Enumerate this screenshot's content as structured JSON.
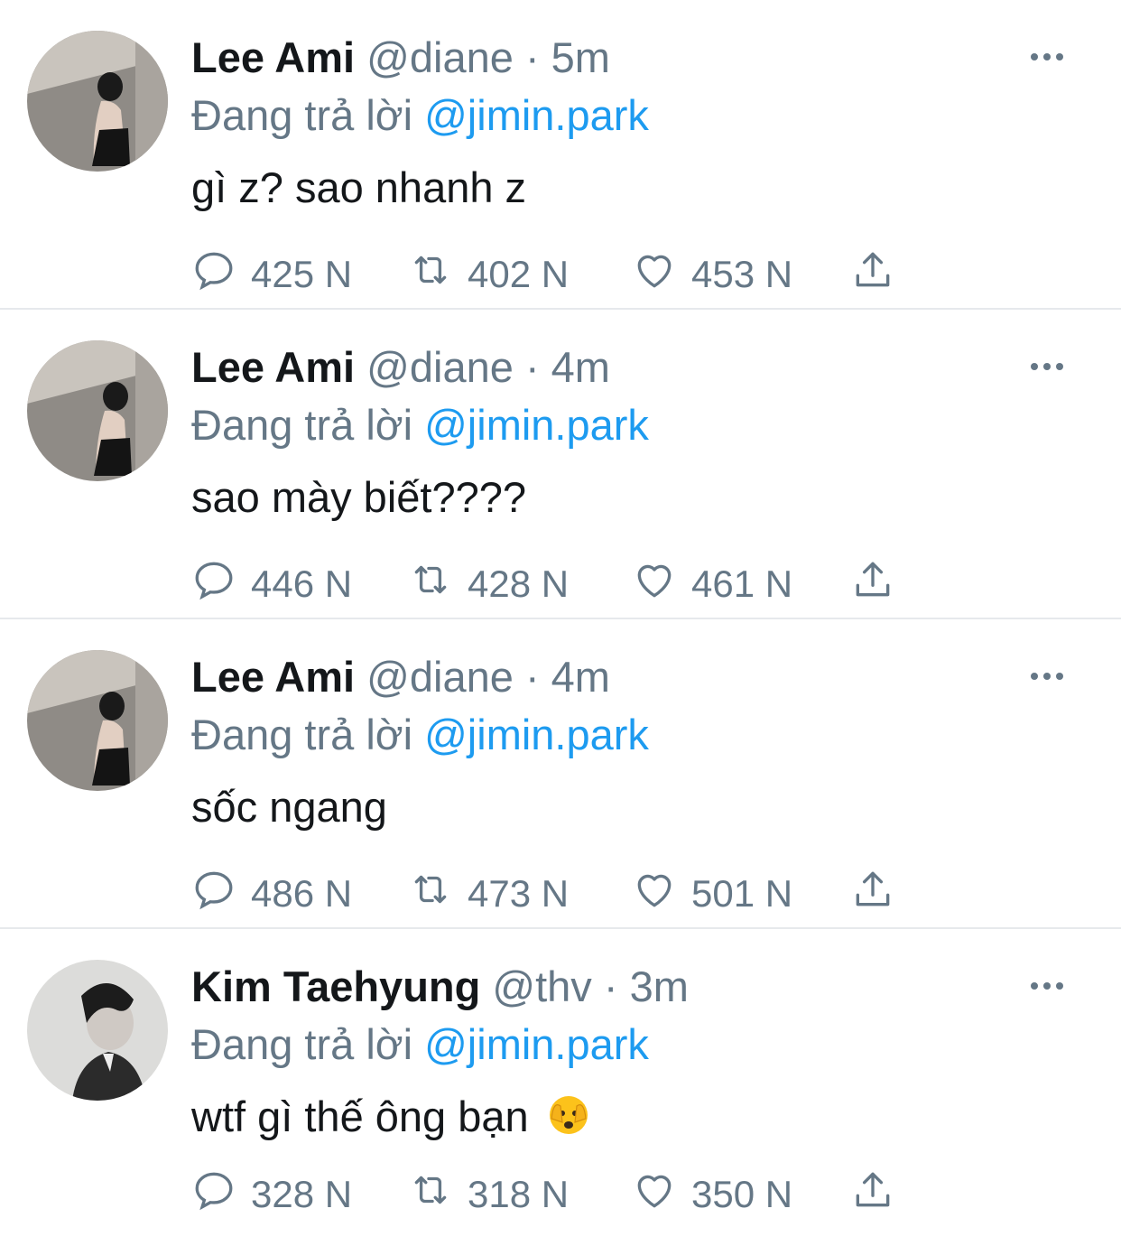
{
  "colors": {
    "text_primary": "#14171a",
    "text_secondary": "#657786",
    "mention": "#1d9bf0",
    "divider": "#e6e9ec"
  },
  "tweets": [
    {
      "name": "Lee Ami",
      "handle": "@diane",
      "dot": "·",
      "time": "5m",
      "reply_prefix": "Đang trả lời",
      "reply_to": "@jimin.park",
      "text": "gì z? sao nhanh z",
      "replies": "425 N",
      "retweets": "402 N",
      "likes": "453 N",
      "avatar": "woman-photo-avatar"
    },
    {
      "name": "Lee Ami",
      "handle": "@diane",
      "dot": "·",
      "time": "4m",
      "reply_prefix": "Đang trả lời",
      "reply_to": "@jimin.park",
      "text": "sao mày biết????",
      "replies": "446 N",
      "retweets": "428 N",
      "likes": "461 N",
      "avatar": "woman-photo-avatar"
    },
    {
      "name": "Lee Ami",
      "handle": "@diane",
      "dot": "·",
      "time": "4m",
      "reply_prefix": "Đang trả lời",
      "reply_to": "@jimin.park",
      "text": "sốc ngang",
      "replies": "486 N",
      "retweets": "473 N",
      "likes": "501 N",
      "avatar": "woman-photo-avatar"
    },
    {
      "name": "Kim Taehyung",
      "handle": "@thv",
      "dot": "·",
      "time": "3m",
      "reply_prefix": "Đang trả lời",
      "reply_to": "@jimin.park",
      "text": "wtf gì thế ông bạn",
      "emoji": "face-peeking-emoji",
      "replies": "328 N",
      "retweets": "318 N",
      "likes": "350 N",
      "avatar": "man-photo-avatar"
    }
  ]
}
